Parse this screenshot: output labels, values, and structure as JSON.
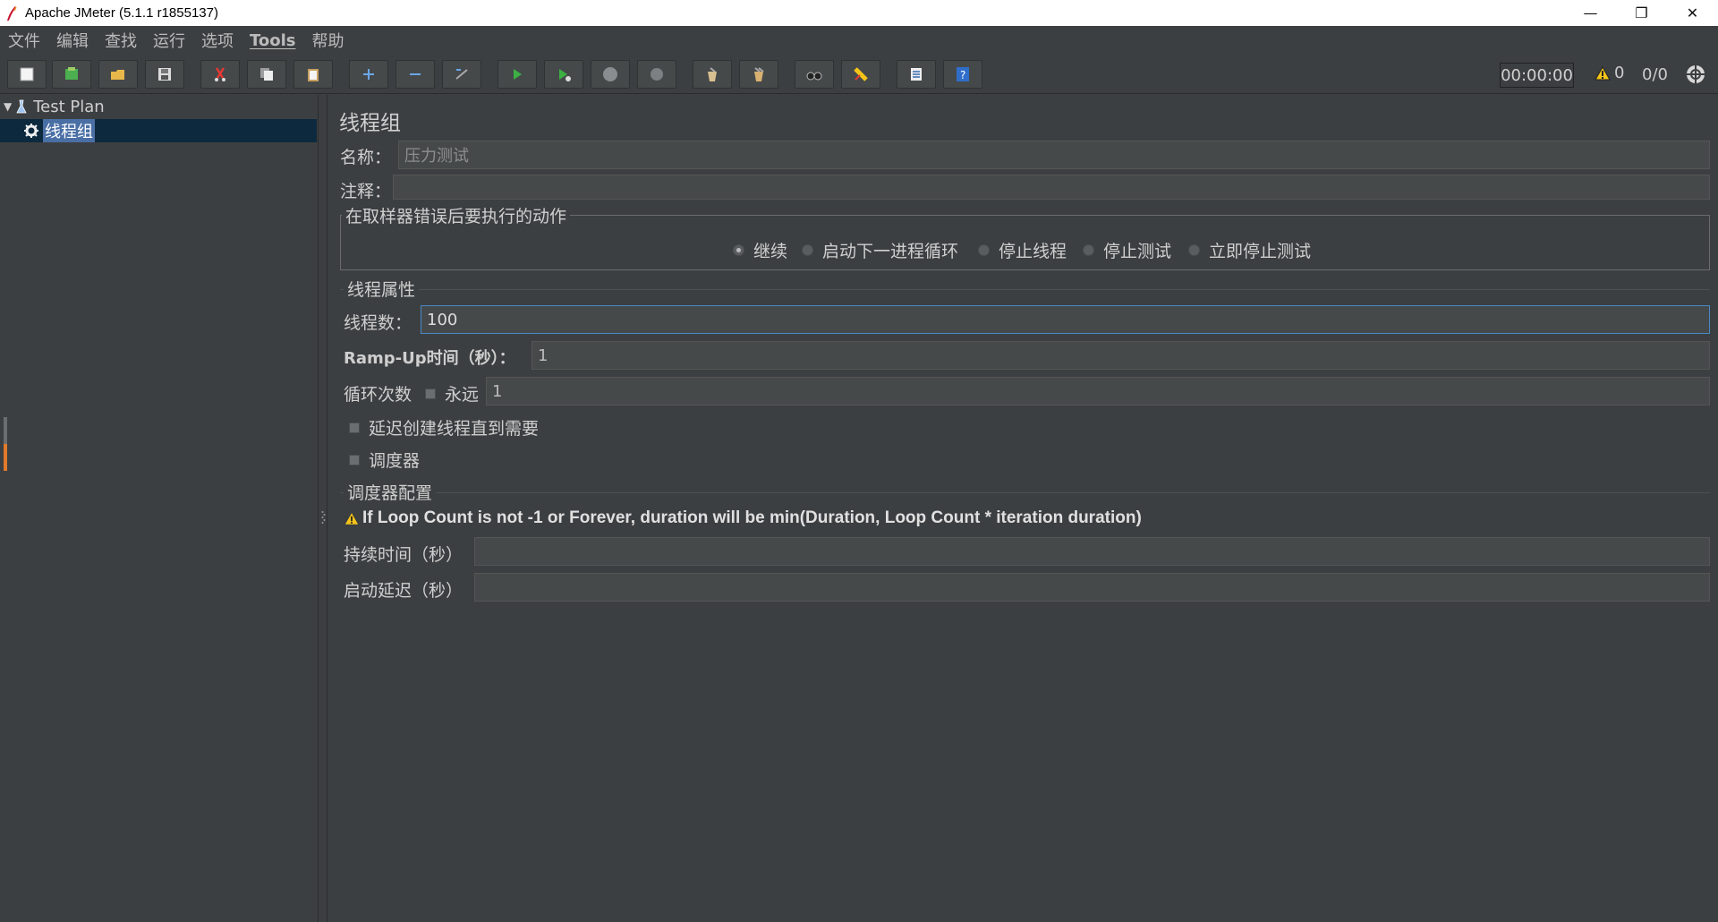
{
  "window": {
    "title": "Apache JMeter (5.1.1 r1855137)",
    "minimize_glyph": "—",
    "restore_glyph": "❐",
    "close_glyph": "✕"
  },
  "menu": {
    "items": [
      "文件",
      "编辑",
      "查找",
      "运行",
      "选项",
      "Tools",
      "帮助"
    ]
  },
  "toolbar": {
    "buttons": [
      "new-icon",
      "templates-icon",
      "open-icon",
      "save-icon",
      "cut-icon",
      "copy-icon",
      "paste-icon",
      "expand-icon",
      "collapse-icon",
      "toggle-icon",
      "start-icon",
      "start-no-pause-icon",
      "stop-icon",
      "shutdown-icon",
      "clear-icon",
      "clear-all-icon",
      "search-icon",
      "reset-search-icon",
      "function-helper-icon",
      "help-icon"
    ],
    "timer": "00:00:00",
    "warning_count": "0",
    "thread_count": "0/0"
  },
  "tree": {
    "test_plan_label": "Test Plan",
    "thread_group_label": "线程组"
  },
  "panel": {
    "title": "线程组",
    "name_label": "名称：",
    "name_value": "压力测试",
    "comment_label": "注释：",
    "comment_value": "",
    "error_action": {
      "title": "在取样器错误后要执行的动作",
      "options": [
        "继续",
        "启动下一进程循环",
        "停止线程",
        "停止测试",
        "立即停止测试"
      ],
      "selected": "继续"
    },
    "thread_props": {
      "title": "线程属性",
      "threads_label": "线程数：",
      "threads_value": "100",
      "rampup_label": "Ramp-Up时间（秒）：",
      "rampup_value": "1",
      "loop_label": "循环次数",
      "forever_label": "永远",
      "loop_value": "1",
      "delay_label": "延迟创建线程直到需要",
      "scheduler_label": "调度器"
    },
    "scheduler": {
      "title": "调度器配置",
      "warning": "If Loop Count is not -1 or Forever, duration will be min(Duration, Loop Count * iteration duration)",
      "duration_label": "持续时间（秒）",
      "duration_value": "",
      "delay_label": "启动延迟（秒）",
      "delay_value": ""
    }
  },
  "colors": {
    "background": "#3c3f41",
    "selection": "#0d293e",
    "label_highlight": "#4a6fa5",
    "accent_green": "#4caf50",
    "warning_yellow": "#f5c518"
  }
}
